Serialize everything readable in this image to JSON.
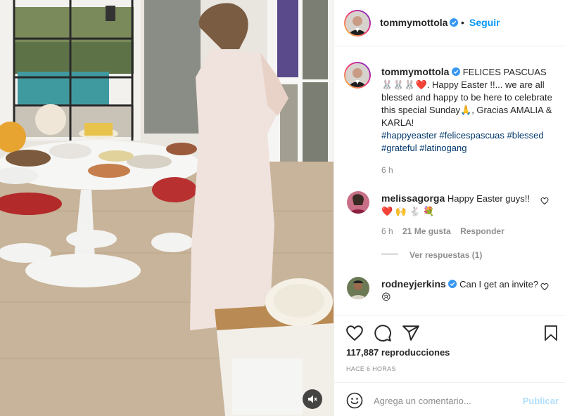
{
  "post": {
    "author": "tommymottola",
    "follow_label": "Seguir",
    "caption": {
      "lead": "FELICES PASCUAS",
      "emojis": [
        "🐰",
        "🐰",
        "🐰",
        "❤️"
      ],
      "body": ". Happy Easter !!... we are all blessed and happy to be here to celebrate this special Sunday",
      "pray_emoji": "🙏",
      "tail": ", Gracias AMALIA & KARLA!",
      "hashtags": [
        "#happyeaster",
        "#felicespascuas",
        "#blessed",
        "#grateful",
        "#latinogang"
      ],
      "time": "6 h"
    },
    "comments": [
      {
        "user": "melissagorga",
        "verified": false,
        "text": "Happy Easter guys!!",
        "emojis": "❤️ 🙌 🐇 💐",
        "time": "6 h",
        "likes": "21 Me gusta",
        "reply_label": "Responder",
        "view_replies": "Ver respuestas (1)"
      },
      {
        "user": "rodneyjerkins",
        "verified": true,
        "text": "Can I get an invite?",
        "emojis": "😢"
      }
    ],
    "views": "117,887 reproducciones",
    "time_ago": "HACE 6 HORAS",
    "add_comment_placeholder": "Agrega un comentario...",
    "publish_label": "Publicar"
  },
  "colors": {
    "link": "#0095f6",
    "hashtag": "#00376b",
    "muted": "#8e8e8e",
    "publish_disabled": "#b2dffc",
    "verified": "#3897f0",
    "heart_red": "#ed4956"
  },
  "icons": [
    "verified-badge-icon",
    "heart-icon",
    "comment-icon",
    "share-icon",
    "bookmark-icon",
    "emoji-icon",
    "mute-icon"
  ]
}
